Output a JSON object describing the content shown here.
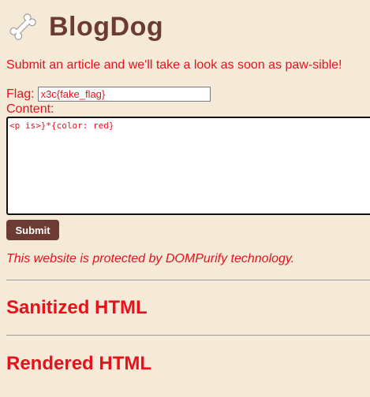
{
  "app": {
    "title": "BlogDog",
    "logo_icon": "bone-icon",
    "title_color": "#6b3b34"
  },
  "intro": "Submit an article and we'll take a look as soon as paw-sible!",
  "form": {
    "flag_label": "Flag:",
    "flag_value": "x3c{fake_flag}",
    "content_label": "Content:",
    "content_value": "<p is>}*{color: red}",
    "submit_label": "Submit"
  },
  "notice": "This website is protected by DOMPurify technology.",
  "sections": {
    "sanitized_heading": "Sanitized HTML",
    "rendered_heading": "Rendered HTML"
  },
  "colors": {
    "background": "#f5ead8",
    "text": "#e8111b",
    "brand": "#6b3b34"
  }
}
